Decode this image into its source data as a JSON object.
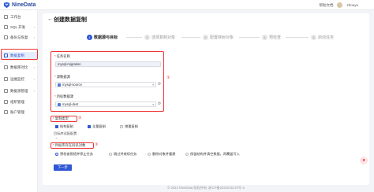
{
  "app": {
    "brand": "NineData"
  },
  "topbar": {
    "help": "帮助文档",
    "user": "zhouyu"
  },
  "sidebar": {
    "items": [
      {
        "label": "工作台",
        "icon": "home-icon",
        "chevron": ""
      },
      {
        "label": "SQL 开发",
        "icon": "code-icon",
        "chevron": "›"
      },
      {
        "label": "备份与恢复",
        "icon": "backup-icon",
        "chevron": "›"
      },
      {
        "label": "数据复制",
        "icon": "replication-icon",
        "chevron": ""
      },
      {
        "label": "数据库对比",
        "icon": "compare-icon",
        "chevron": "›"
      },
      {
        "label": "运维监控",
        "icon": "monitor-icon",
        "chevron": "›"
      },
      {
        "label": "数据源管理",
        "icon": "datasource-icon",
        "chevron": "›"
      },
      {
        "label": "组织管理",
        "icon": "org-icon",
        "chevron": ""
      },
      {
        "label": "账户管理",
        "icon": "account-icon",
        "chevron": ""
      }
    ]
  },
  "page": {
    "back": "←",
    "title": "创建数据复制"
  },
  "steps": [
    {
      "num": "1",
      "label": "数据源与目标"
    },
    {
      "num": "2",
      "label": "选择复制对象"
    },
    {
      "num": "3",
      "label": "配置映射对象"
    },
    {
      "num": "4",
      "label": "预检查"
    },
    {
      "num": "5",
      "label": "启动任务"
    }
  ],
  "form": {
    "req": "*",
    "task_name_label": "任务名称",
    "task_name_value": "mysql-migration",
    "source_label": "源数据源",
    "source_value": "mysql-source",
    "target_label": "目标数据源",
    "target_value": "mysql-dest",
    "caret": "▾",
    "refresh": "⟳",
    "marker1": "①",
    "copy_type_label": "复制类型",
    "marker2": "②",
    "copy_types": [
      {
        "label": "结构复制",
        "checked": true
      },
      {
        "label": "全量复制",
        "checked": true
      },
      {
        "label": "增量复制",
        "checked": false
      }
    ],
    "target_config": "目标库适配配置",
    "collapse": "⌃",
    "conflict_label": "目标库存在同名对象",
    "marker3": "③",
    "conflict_options": [
      {
        "label": "预检查报错并停止任务",
        "selected": true
      },
      {
        "label": "跳过并继续任务",
        "selected": false
      },
      {
        "label": "删除对象并重建",
        "selected": false
      },
      {
        "label": "保留结构并清空数据，再覆盖写入",
        "selected": false
      }
    ],
    "next_button": "下一步"
  },
  "footer": "© 2023 NineData 版权所有   浙ICP备2022015170号-2",
  "float_button": "●"
}
